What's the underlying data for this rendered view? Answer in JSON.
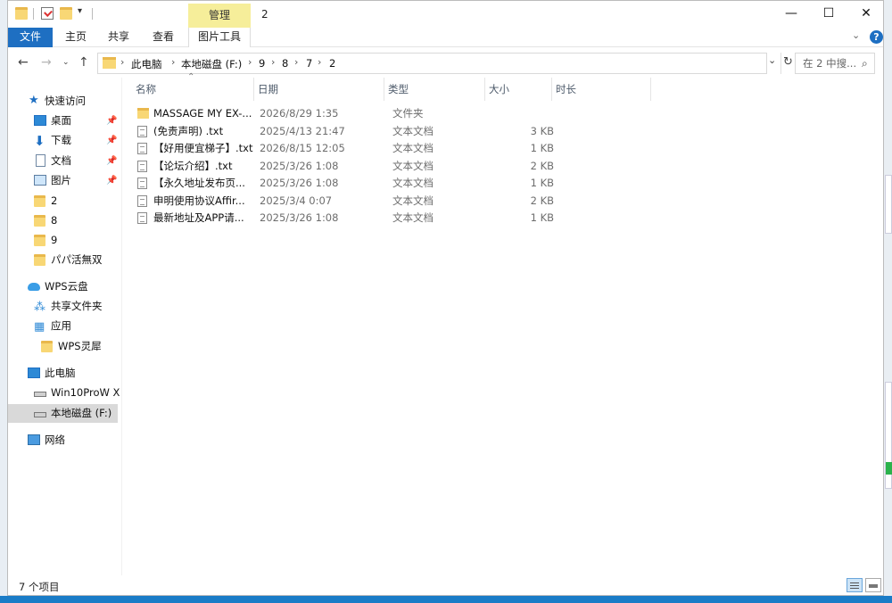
{
  "title_bar": {
    "context_tab_label": "管理",
    "window_title": "2",
    "controls": [
      "minimize-icon",
      "maximize-icon",
      "close-icon"
    ]
  },
  "ribbon": {
    "tabs": [
      "文件",
      "主页",
      "共享",
      "查看",
      "图片工具"
    ],
    "help_label": "?"
  },
  "address_bar": {
    "breadcrumbs": [
      "此电脑",
      "本地磁盘 (F:)",
      "9",
      "8",
      "7",
      "2"
    ],
    "search_placeholder": "在 2 中搜..."
  },
  "nav_pane": {
    "quick_access_label": "快速访问",
    "quick_access": [
      {
        "label": "桌面",
        "pinned": true
      },
      {
        "label": "下载",
        "pinned": true
      },
      {
        "label": "文档",
        "pinned": true
      },
      {
        "label": "图片",
        "pinned": true
      },
      {
        "label": "2",
        "pinned": false
      },
      {
        "label": "8",
        "pinned": false
      },
      {
        "label": "9",
        "pinned": false
      },
      {
        "label": "パパ活無双",
        "pinned": false
      }
    ],
    "wps_label": "WPS云盘",
    "wps": [
      "共享文件夹",
      "应用",
      "WPS灵犀"
    ],
    "this_pc_label": "此电脑",
    "drives": [
      "Win10ProW X",
      "本地磁盘 (F:)"
    ],
    "network_label": "网络"
  },
  "file_list": {
    "columns": [
      "名称",
      "日期",
      "类型",
      "大小",
      "时长"
    ],
    "rows": [
      {
        "name": "MASSAGE MY EX-...",
        "date": "2026/8/29 1:35",
        "type": "文件夹",
        "size": "",
        "icon": "folder-icon"
      },
      {
        "name": "(免责声明) .txt",
        "date": "2025/4/13 21:47",
        "type": "文本文档",
        "size": "3 KB",
        "icon": "text-file-icon"
      },
      {
        "name": "【好用便宜梯子】.txt",
        "date": "2026/8/15 12:05",
        "type": "文本文档",
        "size": "1 KB",
        "icon": "text-file-icon"
      },
      {
        "name": "【论坛介绍】.txt",
        "date": "2025/3/26 1:08",
        "type": "文本文档",
        "size": "2 KB",
        "icon": "text-file-icon"
      },
      {
        "name": "【永久地址发布页...",
        "date": "2025/3/26 1:08",
        "type": "文本文档",
        "size": "1 KB",
        "icon": "text-file-icon"
      },
      {
        "name": "申明使用协议Affir...",
        "date": "2025/3/4 0:07",
        "type": "文本文档",
        "size": "2 KB",
        "icon": "text-file-icon"
      },
      {
        "name": "最新地址及APP请...",
        "date": "2025/3/26 1:08",
        "type": "文本文档",
        "size": "1 KB",
        "icon": "text-file-icon"
      }
    ]
  },
  "status_bar": {
    "item_count": "7 个项目"
  },
  "colors": {
    "accent": "#1e6fc2",
    "manage_tab": "#f6ee9a",
    "folder": "#f8d775"
  }
}
